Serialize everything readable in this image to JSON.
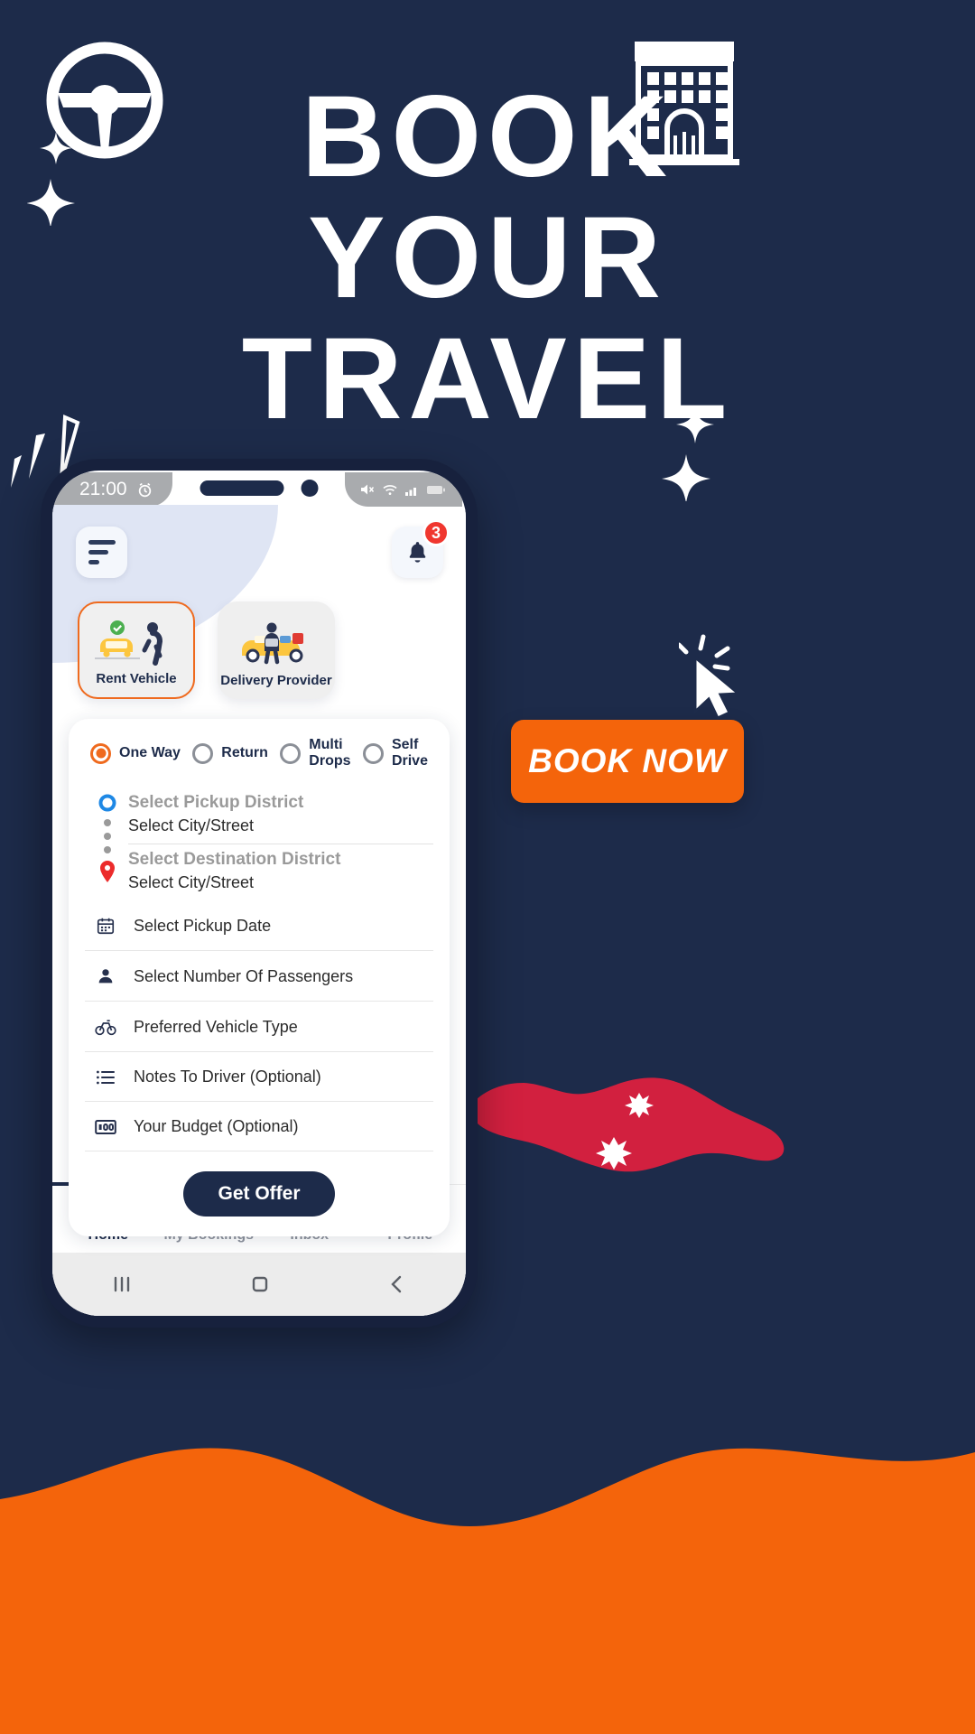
{
  "poster": {
    "headline_line1": "BOOK",
    "headline_line2": "YOUR",
    "headline_line3": "TRAVEL",
    "cta_label": "BOOK NOW",
    "bg_color": "#1d2b4a",
    "accent_color": "#f4640b",
    "map_color": "#d2203f"
  },
  "phone": {
    "statusbar": {
      "time": "21:00",
      "left_icons": [
        "alarm-icon"
      ],
      "right_icons": [
        "mute-icon",
        "wifi-icon",
        "signal-icon",
        "battery-icon"
      ]
    },
    "header": {
      "menu_icon": "hamburger-icon",
      "notification_icon": "bell-icon",
      "notification_count": "3"
    },
    "services": [
      {
        "label": "Rent Vehicle",
        "icon": "car-with-person-icon",
        "selected": true
      },
      {
        "label": "Delivery Provider",
        "icon": "delivery-truck-icon",
        "selected": false
      }
    ],
    "trip_types": [
      {
        "label": "One Way",
        "selected": true
      },
      {
        "label": "Return",
        "selected": false
      },
      {
        "label": "Multi\nDrops",
        "label_l1": "Multi",
        "label_l2": "Drops",
        "selected": false
      },
      {
        "label": "Self\nDrive",
        "label_l1": "Self",
        "label_l2": "Drive",
        "selected": false
      }
    ],
    "route": {
      "pickup_title": "Select Pickup District",
      "pickup_sub": "Select City/Street",
      "destination_title": "Select Destination District",
      "destination_sub": "Select City/Street",
      "pickup_icon": "circle-marker-icon",
      "destination_icon": "location-pin-icon"
    },
    "fields": [
      {
        "label": "Select Pickup Date",
        "icon": "calendar-icon"
      },
      {
        "label": "Select Number Of Passengers",
        "icon": "person-icon"
      },
      {
        "label": "Preferred Vehicle Type",
        "icon": "bicycle-icon"
      },
      {
        "label": "Notes To Driver (Optional)",
        "icon": "list-icon"
      },
      {
        "label": "Your Budget (Optional)",
        "icon": "money-icon"
      }
    ],
    "submit_label": "Get Offer",
    "bottom_nav": [
      {
        "label": "Home",
        "icon": "home-icon",
        "active": true
      },
      {
        "label": "My Bookings",
        "icon": "checklist-icon",
        "active": false
      },
      {
        "label": "Inbox",
        "icon": "chat-icon",
        "active": false
      },
      {
        "label": "Profile",
        "icon": "profile-icon",
        "active": false
      }
    ],
    "android_bar": [
      "recents-icon",
      "home-circle-icon",
      "back-icon"
    ]
  }
}
